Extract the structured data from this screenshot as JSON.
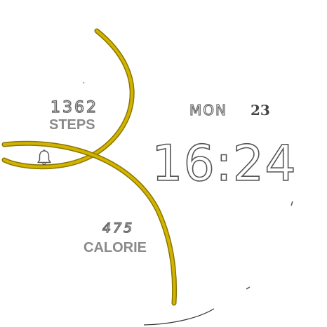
{
  "watchface": {
    "steps": {
      "value": "1362",
      "label": "STEPS"
    },
    "calorie": {
      "value": "475",
      "label": "CALORIE"
    },
    "date": {
      "day": "MON",
      "number": "23"
    },
    "time": "16:24",
    "icons": {
      "alarm": "bell-icon"
    },
    "colors": {
      "accent": "#d2b400",
      "accent_dark": "#8a7600",
      "text": "#6a6a6a"
    }
  }
}
